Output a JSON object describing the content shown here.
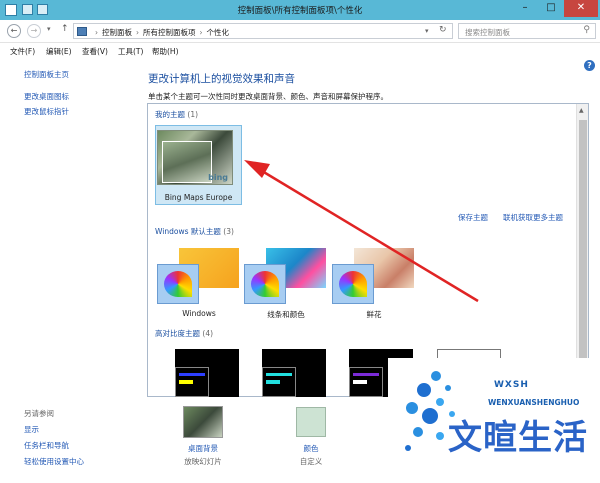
{
  "window": {
    "title": "控制面板\\所有控制面板项\\个性化",
    "min_glyph": "–",
    "max_glyph": "□",
    "close_glyph": "✕"
  },
  "addressbar": {
    "back": "←",
    "forward": "→",
    "dropdown": "▾",
    "up": "↑",
    "crumbs": [
      "控制面板",
      "所有控制面板项",
      "个性化"
    ],
    "crumb_sep": "›",
    "refresh": "↻",
    "search_placeholder": "搜索控制面板",
    "search_icon": "search-icon"
  },
  "menu": [
    "文件(F)",
    "编辑(E)",
    "查看(V)",
    "工具(T)",
    "帮助(H)"
  ],
  "sidebar": {
    "items": [
      "控制面板主页",
      "更改桌面图标",
      "更改鼠标指针"
    ],
    "see_also_title": "另请参阅",
    "see_also": [
      "显示",
      "任务栏和导航",
      "轻松使用设置中心"
    ]
  },
  "help": "?",
  "main": {
    "heading": "更改计算机上的视觉效果和声音",
    "subtitle": "单击某个主题可一次性同时更改桌面背景、颜色、声音和屏幕保护程序。"
  },
  "my_themes": {
    "title": "我的主题",
    "count": "(1)",
    "theme_name": "Bing Maps Europe",
    "logo_text": "bing",
    "save_link": "保存主题",
    "online_link": "联机获取更多主题"
  },
  "windows_themes": {
    "title": "Windows 默认主题",
    "count": "(3)",
    "themes": [
      "Windows",
      "线条和颜色",
      "鲜花"
    ]
  },
  "high_contrast": {
    "title": "高对比度主题",
    "count": "(4)"
  },
  "bottom": {
    "desktop_bg_label": "桌面背景",
    "desktop_bg_value": "放映幻灯片",
    "color_label": "颜色",
    "color_value": "自定义"
  },
  "watermark": {
    "small": "WXSH",
    "pinyin": "WENXUANSHENGHUO",
    "big": "文暄生活"
  },
  "colors": {
    "titlebar": "#58b8d6",
    "link": "#2359b5",
    "heading": "#1b4fa0",
    "selection": "#cfe7f5",
    "arrow": "#e02424"
  }
}
